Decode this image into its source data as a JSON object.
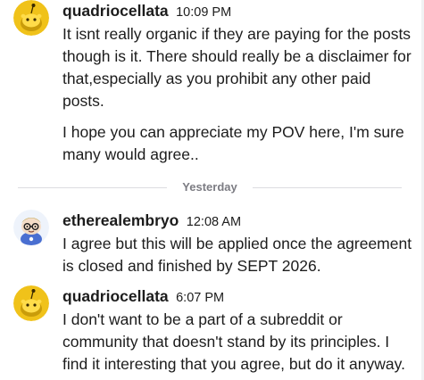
{
  "messages": [
    {
      "username": "quadriocellata",
      "time": "10:09 PM",
      "avatar_icon": "snoo-yellow-avatar-icon",
      "paragraphs": [
        "It isnt really organic if they are paying for the posts though is it. There should really be a disclaimer for that,especially as you prohibit any other paid posts.",
        "I hope you can appreciate my POV here, I'm sure many would agree.."
      ]
    },
    {
      "username": "etherealembryo",
      "time": "12:08 AM",
      "avatar_icon": "snoo-glasses-avatar-icon",
      "paragraphs": [
        "I agree but this will be applied once the agreement is closed and finished by SEPT 2026."
      ]
    },
    {
      "username": "quadriocellata",
      "time": "6:07 PM",
      "avatar_icon": "snoo-yellow-avatar-icon",
      "paragraphs": [
        "I don't want to be a part of a subreddit or community that doesn't stand by its principles. I find it interesting that you agree, but do it anyway."
      ]
    }
  ],
  "date_divider": "Yesterday",
  "colors": {
    "text": "#1c1c1c",
    "muted": "#7c7c83",
    "divider_line": "#dcdde0",
    "avatar_yellow": "#f0c21a",
    "avatar_bg_light": "#eef3fb"
  }
}
